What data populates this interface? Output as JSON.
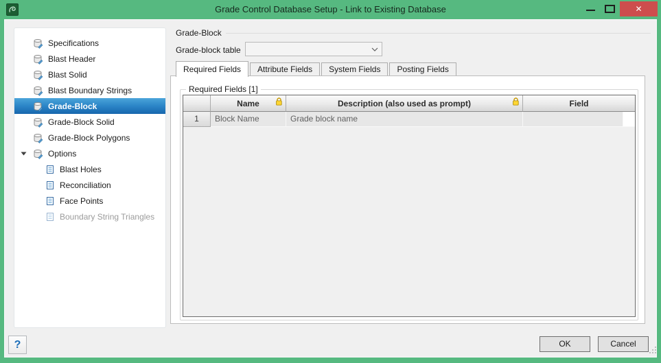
{
  "window": {
    "title": "Grade Control Database Setup - Link to Existing Database",
    "close_glyph": "✕"
  },
  "sidebar": {
    "items": [
      {
        "label": "Specifications",
        "icon": "database-icon",
        "indent": 0
      },
      {
        "label": "Blast Header",
        "icon": "database-icon",
        "indent": 0
      },
      {
        "label": "Blast Solid",
        "icon": "database-icon",
        "indent": 0
      },
      {
        "label": "Blast Boundary Strings",
        "icon": "database-icon",
        "indent": 0
      },
      {
        "label": "Grade-Block",
        "icon": "database-icon",
        "indent": 0,
        "selected": true
      },
      {
        "label": "Grade-Block Solid",
        "icon": "database-icon",
        "indent": 0
      },
      {
        "label": "Grade-Block Polygons",
        "icon": "database-icon",
        "indent": 0
      },
      {
        "label": "Options",
        "icon": "database-icon",
        "indent": 0,
        "expanded": true
      },
      {
        "label": "Blast Holes",
        "icon": "document-icon",
        "indent": 1
      },
      {
        "label": "Reconciliation",
        "icon": "document-icon",
        "indent": 1
      },
      {
        "label": "Face Points",
        "icon": "document-icon",
        "indent": 1
      },
      {
        "label": "Boundary String Triangles",
        "icon": "document-icon",
        "indent": 1,
        "disabled": true
      }
    ]
  },
  "main": {
    "group_title": "Grade-Block",
    "table_selector": {
      "label": "Grade-block table",
      "value": ""
    },
    "tabs": [
      {
        "label": "Required Fields",
        "active": true
      },
      {
        "label": "Attribute Fields",
        "active": false
      },
      {
        "label": "System Fields",
        "active": false
      },
      {
        "label": "Posting Fields",
        "active": false
      }
    ],
    "required_fields_group": {
      "title": "Required Fields [1]",
      "grid": {
        "columns": [
          {
            "label": "",
            "locked": false
          },
          {
            "label": "Name",
            "locked": true
          },
          {
            "label": "Description (also used as prompt)",
            "locked": true
          },
          {
            "label": "Field",
            "locked": false
          }
        ],
        "rows": [
          {
            "row_number": "1",
            "name": "Block Name",
            "description": "Grade block name",
            "field": ""
          }
        ]
      }
    }
  },
  "footer": {
    "help_label": "?",
    "ok_label": "OK",
    "cancel_label": "Cancel"
  },
  "colors": {
    "titlebar_green": "#56b980",
    "close_red": "#cd4d4d",
    "selection_blue": "#2b85c7",
    "lock_gold": "#ffd633"
  }
}
